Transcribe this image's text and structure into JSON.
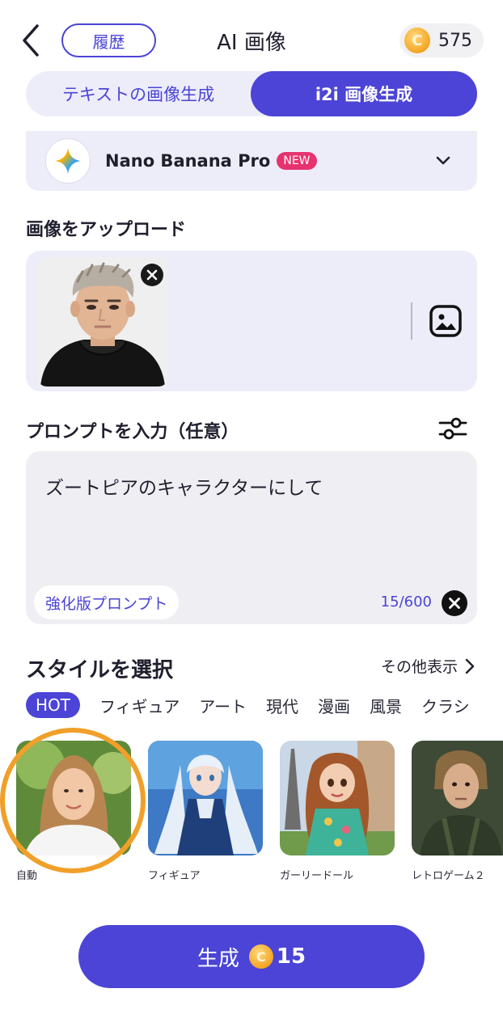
{
  "header": {
    "history_label": "履歴",
    "title": "AI 画像",
    "coin_symbol": "C",
    "coin_balance": "575"
  },
  "mode_tabs": [
    {
      "label": "テキストの画像生成",
      "active": false
    },
    {
      "label": "i2i 画像生成",
      "active": true
    }
  ],
  "model": {
    "name": "Nano Banana Pro",
    "badge": "NEW"
  },
  "upload": {
    "label": "画像をアップロード"
  },
  "prompt": {
    "label": "プロンプトを入力（任意）",
    "text": "ズートピアのキャラクターにして",
    "enhance_label": "強化版プロンプト",
    "count": "15/600"
  },
  "styles": {
    "label": "スタイルを選択",
    "more_label": "その他表示",
    "categories": [
      "HOT",
      "フィギュア",
      "アート",
      "現代",
      "漫画",
      "風景",
      "クラシ"
    ],
    "active_category": "HOT",
    "items": [
      {
        "label": "自動",
        "selected": true
      },
      {
        "label": "フィギュア",
        "selected": false
      },
      {
        "label": "ガーリードール",
        "selected": false
      },
      {
        "label": "レトロゲーム２",
        "selected": false
      }
    ]
  },
  "generate": {
    "label": "生成",
    "cost": "15"
  },
  "colors": {
    "accent": "#4b44d6",
    "card_bg": "#ededfa",
    "coin": "#f3a524",
    "badge": "#e6336f",
    "selection_ring": "#f0a02a"
  }
}
